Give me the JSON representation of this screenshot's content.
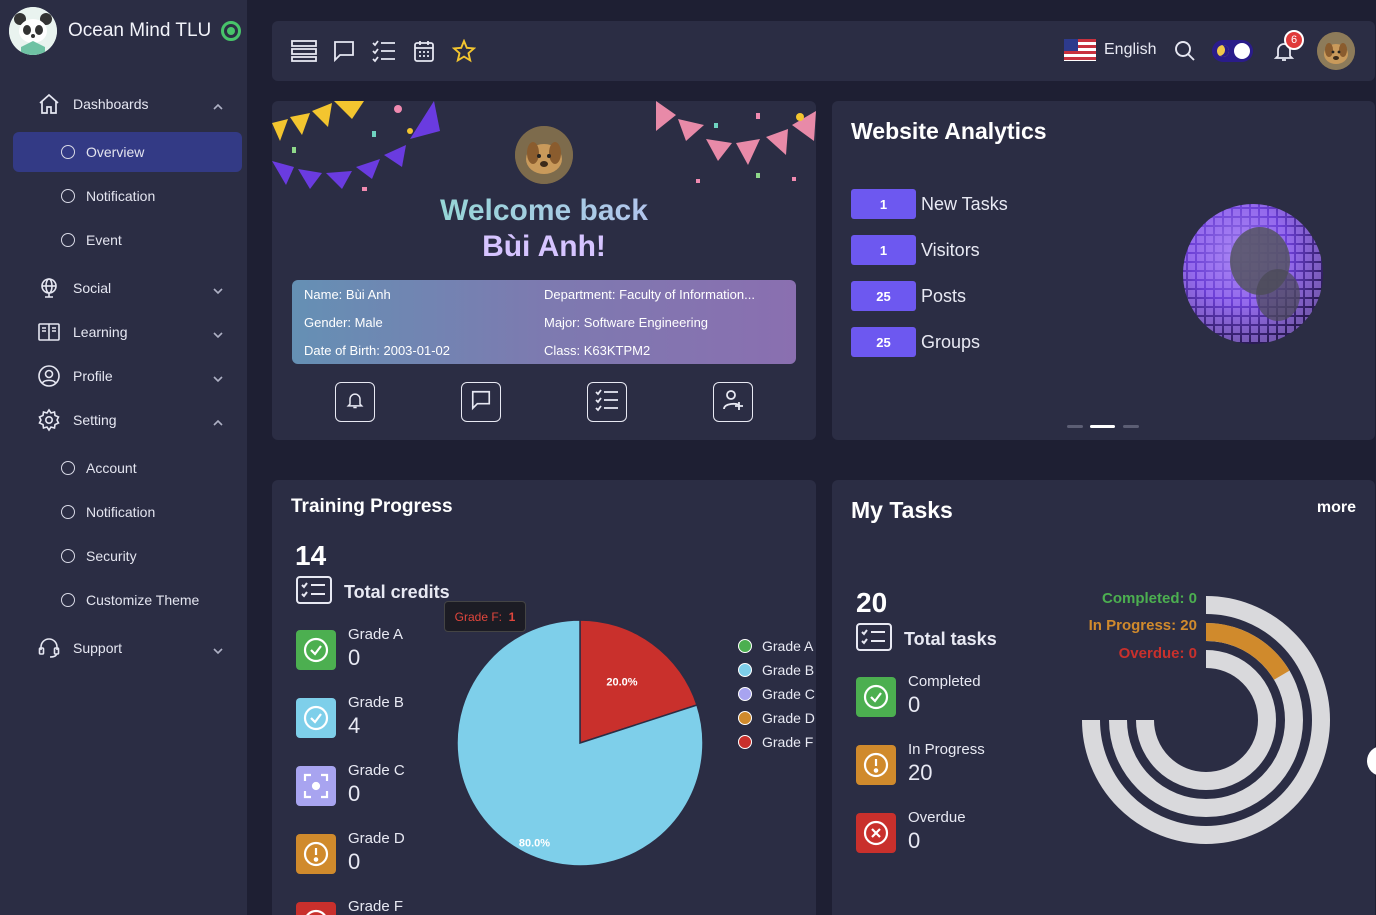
{
  "brand": {
    "title": "Ocean Mind TLU"
  },
  "sidebar": {
    "items": [
      {
        "label": "Dashboards",
        "icon": "home-icon",
        "expanded": true
      },
      {
        "label": "Overview",
        "sub": true,
        "active": true
      },
      {
        "label": "Notification",
        "sub": true
      },
      {
        "label": "Event",
        "sub": true
      },
      {
        "label": "Social",
        "icon": "globe-icon"
      },
      {
        "label": "Learning",
        "icon": "book-icon"
      },
      {
        "label": "Profile",
        "icon": "user-circle-icon"
      },
      {
        "label": "Setting",
        "icon": "gear-icon",
        "expanded": true
      },
      {
        "label": "Account",
        "sub": true
      },
      {
        "label": "Notification",
        "sub": true
      },
      {
        "label": "Security",
        "sub": true
      },
      {
        "label": "Customize Theme",
        "sub": true
      },
      {
        "label": "Support",
        "icon": "headset-icon"
      }
    ]
  },
  "topbar": {
    "language": "English",
    "notification_count": "6"
  },
  "welcome": {
    "line1": "Welcome back",
    "line2": "Bùi Anh!",
    "info": {
      "name": "Name: Bùi Anh",
      "gender": "Gender: Male",
      "dob": "Date of Birth: 2003-01-02",
      "department": "Department: Faculty of Information...",
      "major": "Major: Software Engineering",
      "class": "Class: K63KTPM2"
    }
  },
  "analytics": {
    "title": "Website Analytics",
    "stats": [
      {
        "value": "1",
        "label": "New Tasks"
      },
      {
        "value": "1",
        "label": "Visitors"
      },
      {
        "value": "25",
        "label": "Posts"
      },
      {
        "value": "25",
        "label": "Groups"
      }
    ]
  },
  "training": {
    "title": "Training Progress",
    "total_value": "14",
    "total_label": "Total credits",
    "grades": [
      {
        "label": "Grade A",
        "value": "0",
        "color": "#4caf50"
      },
      {
        "label": "Grade B",
        "value": "4",
        "color": "#7ecfea"
      },
      {
        "label": "Grade C",
        "value": "0",
        "color": "#a8a4f0"
      },
      {
        "label": "Grade D",
        "value": "0",
        "color": "#d08a2c"
      },
      {
        "label": "Grade F",
        "value": "",
        "color": "#c9302c"
      }
    ],
    "tooltip": {
      "label": "Grade F:",
      "value": "1"
    }
  },
  "chart_data": {
    "type": "pie",
    "categories": [
      "Grade A",
      "Grade B",
      "Grade C",
      "Grade D",
      "Grade F"
    ],
    "values": [
      0,
      80.0,
      0,
      0,
      20.0
    ],
    "data_labels": [
      "",
      "80.0%",
      "",
      "",
      "20.0%"
    ],
    "colors": [
      "#4caf50",
      "#7ecfea",
      "#a8a4f0",
      "#d08a2c",
      "#c9302c"
    ],
    "legend": "right"
  },
  "tasks": {
    "title": "My Tasks",
    "more": "more",
    "total_value": "20",
    "total_label": "Total tasks",
    "rows": [
      {
        "label": "Completed",
        "value": "0",
        "color": "#4caf50"
      },
      {
        "label": "In Progress",
        "value": "20",
        "color": "#d08a2c"
      },
      {
        "label": "Overdue",
        "value": "0",
        "color": "#c9302c"
      }
    ],
    "legend": [
      {
        "text": "Completed: 0",
        "color": "#4caf50"
      },
      {
        "text": "In Progress: 20",
        "color": "#d08a2c"
      },
      {
        "text": "Overdue: 0",
        "color": "#c9302c"
      }
    ]
  }
}
